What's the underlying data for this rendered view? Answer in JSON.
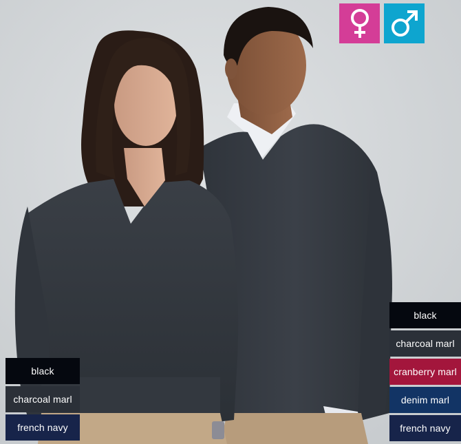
{
  "gender_badges": [
    {
      "icon": "female-symbol-icon",
      "color": "#d43d97"
    },
    {
      "icon": "male-symbol-icon",
      "color": "#0ea5cf"
    }
  ],
  "women_colours": [
    {
      "label": "black",
      "color": "#05080f"
    },
    {
      "label": "charcoal marl",
      "color": "#2b3038"
    },
    {
      "label": "french navy",
      "color": "#17244a"
    }
  ],
  "men_colours": [
    {
      "label": "black",
      "color": "#05080f"
    },
    {
      "label": "charcoal marl",
      "color": "#2b3038"
    },
    {
      "label": "cranberry marl",
      "color": "#a3163c"
    },
    {
      "label": "denim marl",
      "color": "#123465"
    },
    {
      "label": "french navy",
      "color": "#17244a"
    }
  ]
}
